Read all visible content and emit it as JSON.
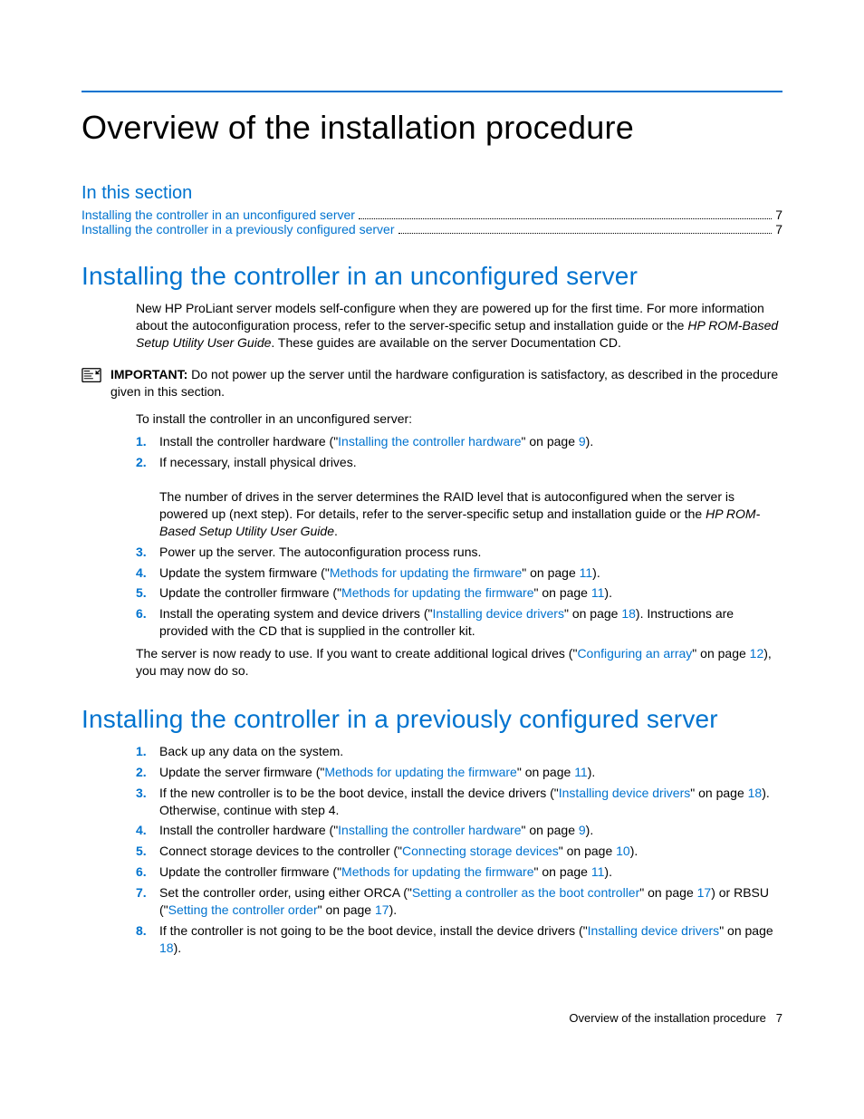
{
  "title": "Overview of the installation procedure",
  "toc": {
    "heading": "In this section",
    "items": [
      {
        "label": "Installing the controller in an unconfigured server",
        "page": "7"
      },
      {
        "label": "Installing the controller in a previously configured server",
        "page": "7"
      }
    ]
  },
  "sectionA": {
    "heading": "Installing the controller in an unconfigured server",
    "intro_pre": "New HP ProLiant server models self-configure when they are powered up for the first time. For more information about the autoconfiguration process, refer to the server-specific setup and installation guide or the ",
    "intro_italic": "HP ROM-Based Setup Utility User Guide",
    "intro_post": ". These guides are available on the server Documentation CD.",
    "important_label": "IMPORTANT:",
    "important_text": "  Do not power up the server until the hardware configuration is satisfactory, as described in the procedure given in this section.",
    "lead": "To install the controller in an unconfigured server:",
    "steps": {
      "s1_pre": "Install the controller hardware (\"",
      "s1_link": "Installing the controller hardware",
      "s1_mid": "\" on page ",
      "s1_pg": "9",
      "s1_post": ").",
      "s2": "If necessary, install physical drives.",
      "s2_detail_pre": "The number of drives in the server determines the RAID level that is autoconfigured when the server is powered up (next step). For details, refer to the server-specific setup and installation guide or the ",
      "s2_detail_italic": "HP ROM-Based Setup Utility User Guide",
      "s2_detail_post": ".",
      "s3": "Power up the server. The autoconfiguration process runs.",
      "s4_pre": "Update the system firmware (\"",
      "s4_link": "Methods for updating the firmware",
      "s4_mid": "\" on page ",
      "s4_pg": "11",
      "s4_post": ").",
      "s5_pre": "Update the controller firmware (\"",
      "s5_link": "Methods for updating the firmware",
      "s5_mid": "\" on page ",
      "s5_pg": "11",
      "s5_post": ").",
      "s6_pre": "Install the operating system and device drivers (\"",
      "s6_link": "Installing device drivers",
      "s6_mid": "\" on page ",
      "s6_pg": "18",
      "s6_post": "). Instructions are provided with the CD that is supplied in the controller kit."
    },
    "outro_pre": "The server is now ready to use. If you want to create additional logical drives (\"",
    "outro_link": "Configuring an array",
    "outro_mid": "\" on page ",
    "outro_pg": "12",
    "outro_post": "), you may now do so."
  },
  "sectionB": {
    "heading": "Installing the controller in a previously configured server",
    "steps": {
      "s1": "Back up any data on the system.",
      "s2_pre": "Update the server firmware (\"",
      "s2_link": "Methods for updating the firmware",
      "s2_mid": "\" on page ",
      "s2_pg": "11",
      "s2_post": ").",
      "s3_pre": "If the new controller is to be the boot device, install the device drivers (\"",
      "s3_link": "Installing device drivers",
      "s3_mid": "\" on page ",
      "s3_pg": "18",
      "s3_post": "). Otherwise, continue with step 4.",
      "s4_pre": "Install the controller hardware (\"",
      "s4_link": "Installing the controller hardware",
      "s4_mid": "\" on page ",
      "s4_pg": "9",
      "s4_post": ").",
      "s5_pre": "Connect storage devices to the controller (\"",
      "s5_link": "Connecting storage devices",
      "s5_mid": "\" on page ",
      "s5_pg": "10",
      "s5_post": ").",
      "s6_pre": "Update the controller firmware (\"",
      "s6_link": "Methods for updating the firmware",
      "s6_mid": "\" on page ",
      "s6_pg": "11",
      "s6_post": ").",
      "s7_pre": "Set the controller order, using either ORCA (\"",
      "s7_link1": "Setting a controller as the boot controller",
      "s7_mid1": "\" on page ",
      "s7_pg1": "17",
      "s7_mid2": ") or RBSU (\"",
      "s7_link2": "Setting the controller order",
      "s7_mid3": "\" on page ",
      "s7_pg2": "17",
      "s7_post": ").",
      "s8_pre": "If the controller is not going to be the boot device, install the device drivers (\"",
      "s8_link": "Installing device drivers",
      "s8_mid": "\" on page ",
      "s8_pg": "18",
      "s8_post": ")."
    }
  },
  "footer": {
    "label": "Overview of the installation procedure",
    "page": "7"
  }
}
